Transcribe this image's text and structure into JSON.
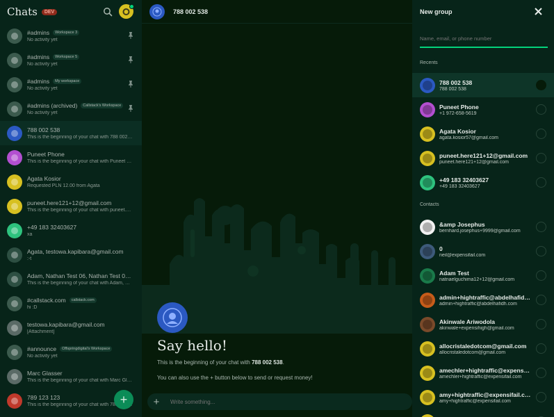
{
  "lhn": {
    "title": "Chats",
    "badge": "DEV",
    "chats": [
      {
        "name": "#admins",
        "workspace": "Workspace 3",
        "subtitle": "No activity yet",
        "avatar": "shield-icon",
        "pinned": true
      },
      {
        "name": "#admins",
        "workspace": "Workspace 5",
        "subtitle": "No activity yet",
        "avatar": "shield-icon",
        "pinned": true
      },
      {
        "name": "#admins",
        "workspace": "My workspace",
        "subtitle": "No activity yet",
        "avatar": "shield-icon",
        "pinned": true
      },
      {
        "name": "#admins (archived)",
        "workspace": "Callstack's Workspace",
        "subtitle": "No activity yet",
        "avatar": "trash-icon",
        "pinned": true
      },
      {
        "name": "788 002 538",
        "subtitle": "This is the beginning of your chat with 788 002 538.",
        "avatar": "blue-avatar",
        "active": true
      },
      {
        "name": "Puneet Phone",
        "subtitle": "This is the beginning of your chat with Puneet Phone.",
        "avatar": "purple-avatar"
      },
      {
        "name": "Agata Kosior",
        "subtitle": "Requested PLN 12.00 from Agata",
        "avatar": "yellow-avatar"
      },
      {
        "name": "puneet.here121+12@gmail.com",
        "subtitle": "This is the beginning of your chat with puneet.here121+12@gmail.com.",
        "avatar": "yellow-avatar"
      },
      {
        "name": "+49 183 32403627",
        "subtitle": "xa",
        "avatar": "green-avatar"
      },
      {
        "name": "Agata, testowa.kapibara@gmail.com",
        "subtitle": ":-t",
        "avatar": "group-avatar"
      },
      {
        "name": "Adam, Nathan Test 06, Nathan Test 01, N...",
        "subtitle": "This is the beginning of your chat with Adam, Nathan Test 06.",
        "avatar": "group-avatar"
      },
      {
        "name": "#callstack.com",
        "workspace": "callstack.com",
        "subtitle": "hi :D",
        "avatar": "globe-icon"
      },
      {
        "name": "testowa.kapibara@gmail.com",
        "subtitle": "[Attachment]",
        "avatar": "photo-avatar"
      },
      {
        "name": "#announce",
        "workspace": "Offspringdigital's Workspace",
        "subtitle": "No activity yet",
        "avatar": "megaphone-icon"
      },
      {
        "name": "Marc Glasser",
        "subtitle": "This is the beginning of your chat with Marc Glasser.",
        "avatar": "photo-avatar"
      },
      {
        "name": "789 123 123",
        "subtitle": "This is the beginning of your chat with 789 123 123.",
        "avatar": "red-avatar"
      }
    ]
  },
  "main": {
    "header_title": "788 002 538",
    "say_hello": "Say hello!",
    "welcome_prefix": "This is the beginning of your chat with ",
    "welcome_name": "788 002 538",
    "welcome_suffix": ".",
    "welcome_line2": "You can also use the + button below to send or request money!",
    "composer_placeholder": "Write something..."
  },
  "rhp": {
    "title": "New group",
    "search_placeholder": "Name, email, or phone number",
    "recents_label": "Recents",
    "contacts_label": "Contacts",
    "recents": [
      {
        "name": "788 002 538",
        "sub": "788 002 538",
        "color": "#2b59c2",
        "selected": true
      },
      {
        "name": "Puneet Phone",
        "sub": "+1 972-658-5619",
        "color": "#b34fd0"
      },
      {
        "name": "Agata Kosior",
        "sub": "agata.kosior57@gmail.com",
        "color": "#d7c021"
      },
      {
        "name": "puneet.here121+12@gmail.com",
        "sub": "puneet.here121+12@gmail.com",
        "color": "#d7c021"
      },
      {
        "name": "+49 183 32403627",
        "sub": "+49 183 32403627",
        "color": "#2ec27e"
      }
    ],
    "contacts": [
      {
        "name": "&amp     Josephus",
        "sub": "bernhard.josephus+9999@gmail.com",
        "color": "#f1f1f1"
      },
      {
        "name": "0",
        "sub": "neil@expensifail.com",
        "color": "#3d5a7a"
      },
      {
        "name": "Adam Test",
        "sub": "natnaelguchima12+12@gmail.com",
        "color": "#1a7a4a"
      },
      {
        "name": "admin+hightraffic@abdelhafidh.com",
        "sub": "admin+hightraffic@abdelhafidh.com",
        "color": "#c65c1a"
      },
      {
        "name": "Akinwale Ariwodola",
        "sub": "akinwale+expensihigh@gmail.com",
        "color": "#7a4a2a"
      },
      {
        "name": "allocristaledotcom@gmail.com",
        "sub": "allocristaledotcom@gmail.com",
        "color": "#d7c021"
      },
      {
        "name": "amechler+hightraffic@expensifail...",
        "sub": "amechler+hightraffic@expensifail.com",
        "color": "#d7c021"
      },
      {
        "name": "amy+hightraffic@expensifail.com",
        "sub": "amy+hightraffic@expensifail.com",
        "color": "#d7c021"
      },
      {
        "name": "Andrew Lee",
        "sub": "",
        "color": "#d7c021"
      }
    ]
  }
}
